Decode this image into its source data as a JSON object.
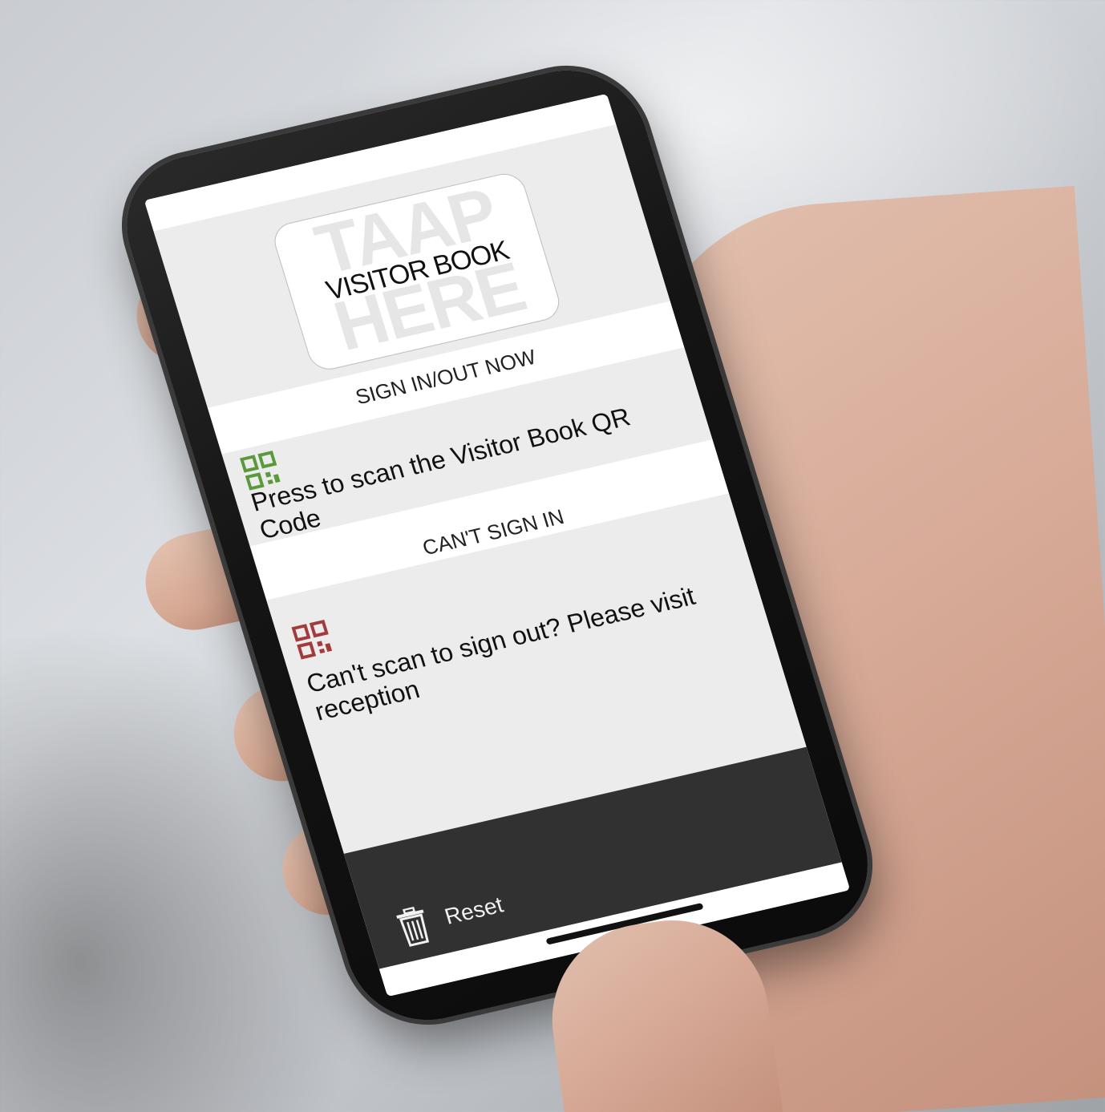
{
  "logo": {
    "bg_top": "TAAP",
    "main": "VISITOR BOOK",
    "bg_bottom": "HERE"
  },
  "sign_in": {
    "title": "SIGN IN/OUT NOW",
    "action": "Press to scan the Visitor Book QR Code",
    "icon": "qr-code-icon",
    "icon_color": "#5a9a3c"
  },
  "cant_sign_in": {
    "title": "CAN'T SIGN IN",
    "action": "Can't scan to sign out? Please visit reception",
    "icon": "qr-code-icon",
    "icon_color": "#a23b3b"
  },
  "footer": {
    "reset_label": "Reset",
    "reset_icon": "trash-icon",
    "bar_color": "#313131"
  }
}
